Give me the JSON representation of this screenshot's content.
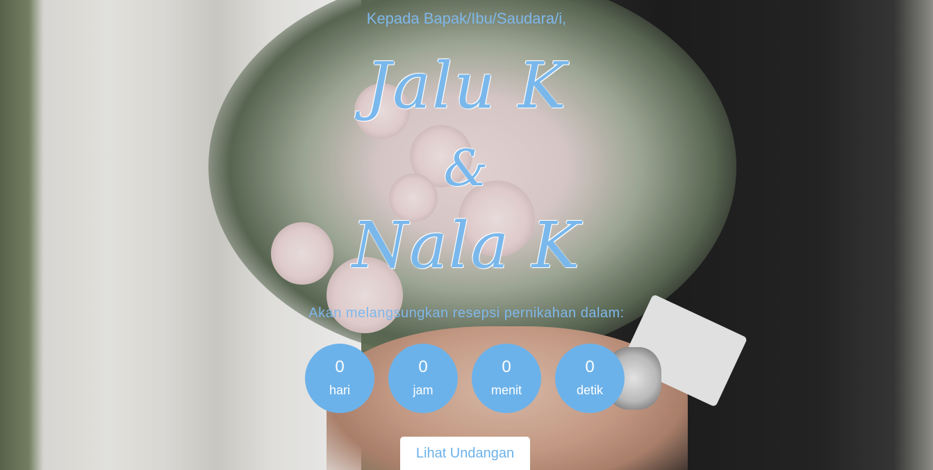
{
  "greeting": "Kepada Bapak/Ibu/Saudara/i,",
  "couple": {
    "groom": "Jalu K",
    "ampersand": "&",
    "bride": "Nala K"
  },
  "subtitle": "Akan melangsungkan resepsi pernikahan dalam:",
  "countdown": [
    {
      "value": "0",
      "unit": "hari"
    },
    {
      "value": "0",
      "unit": "jam"
    },
    {
      "value": "0",
      "unit": "menit"
    },
    {
      "value": "0",
      "unit": "detik"
    }
  ],
  "cta_label": "Lihat Undangan",
  "colors": {
    "accent": "#6cb2ea",
    "text_accent": "#7fb7ea",
    "button_bg": "#ffffff"
  }
}
